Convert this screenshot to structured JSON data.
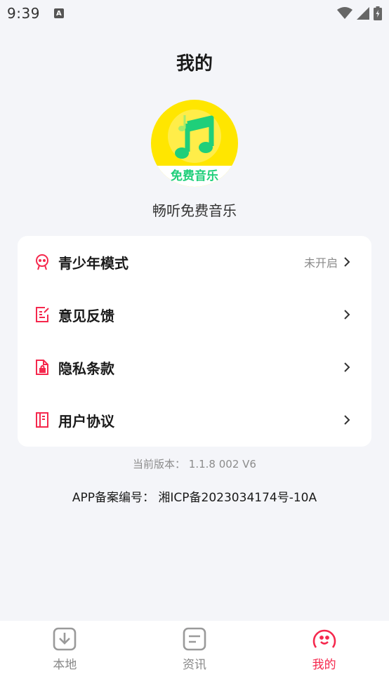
{
  "status_bar": {
    "time": "9:39",
    "notification_icon": "A"
  },
  "header": {
    "title": "我的"
  },
  "logo": {
    "text": "免费音乐",
    "icon": "music-note-icon"
  },
  "app": {
    "name": "畅听免费音乐"
  },
  "menu": {
    "items": [
      {
        "label": "青少年模式",
        "status": "未开启",
        "icon": "teen-mode-icon"
      },
      {
        "label": "意见反馈",
        "status": "",
        "icon": "feedback-icon"
      },
      {
        "label": "隐私条款",
        "status": "",
        "icon": "privacy-icon"
      },
      {
        "label": "用户协议",
        "status": "",
        "icon": "agreement-icon"
      }
    ]
  },
  "footer": {
    "version": "当前版本： 1.1.8 002 V6",
    "icp": "APP备案编号： 湘ICP备2023034174号-10A"
  },
  "tabs": [
    {
      "label": "本地",
      "icon": "download-icon",
      "active": false
    },
    {
      "label": "资讯",
      "icon": "news-icon",
      "active": false
    },
    {
      "label": "我的",
      "icon": "profile-face-icon",
      "active": true
    }
  ],
  "colors": {
    "accent": "#f5284d",
    "logo_yellow": "#ffe600",
    "logo_green": "#1fcf7a",
    "background": "#f4f5f9"
  }
}
